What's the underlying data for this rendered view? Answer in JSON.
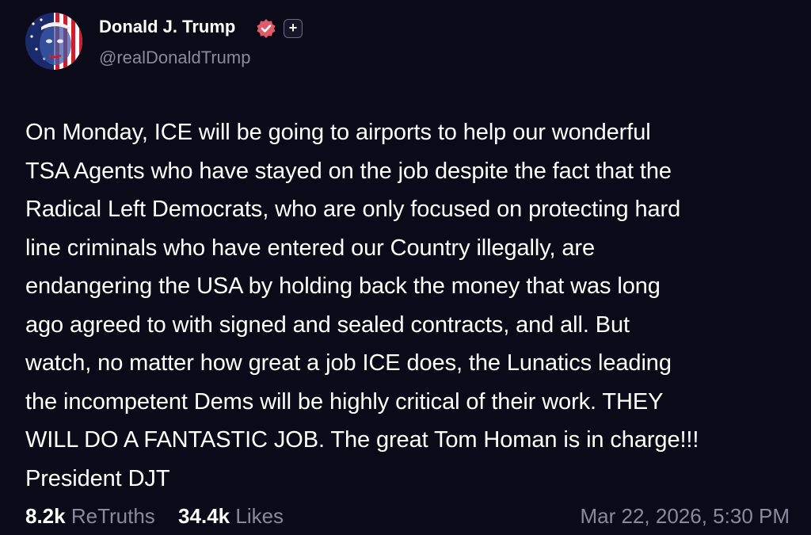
{
  "colors": {
    "background": "#0b0a19",
    "text_primary": "#ffffff",
    "text_secondary": "#8b8a9c",
    "verified_badge": "#e05a6a"
  },
  "author": {
    "display_name": "Donald J. Trump",
    "handle": "@realDonaldTrump",
    "avatar_icon": "avatar-flag-portrait",
    "verified_icon": "verified-badge-icon",
    "plus_icon": "plus-icon",
    "plus_glyph": "+"
  },
  "post": {
    "text": "On Monday, ICE will be going to airports to help our wonderful\nTSA Agents who have stayed on the job despite the fact that the\nRadical Left Democrats, who are only focused on protecting hard\nline criminals who have entered our Country illegally, are\nendangering the USA by holding back the money that was long\nago agreed to with signed and sealed contracts, and all. But\nwatch, no matter how great a job ICE does, the Lunatics leading\nthe incompetent Dems will be highly critical of their work. THEY\nWILL DO A FANTASTIC JOB. The great Tom Homan is in charge!!!\nPresident DJT"
  },
  "stats": {
    "retruths_count": "8.2k",
    "retruths_label": "ReTruths",
    "likes_count": "34.4k",
    "likes_label": "Likes",
    "timestamp": "Mar 22, 2026, 5:30 PM"
  }
}
